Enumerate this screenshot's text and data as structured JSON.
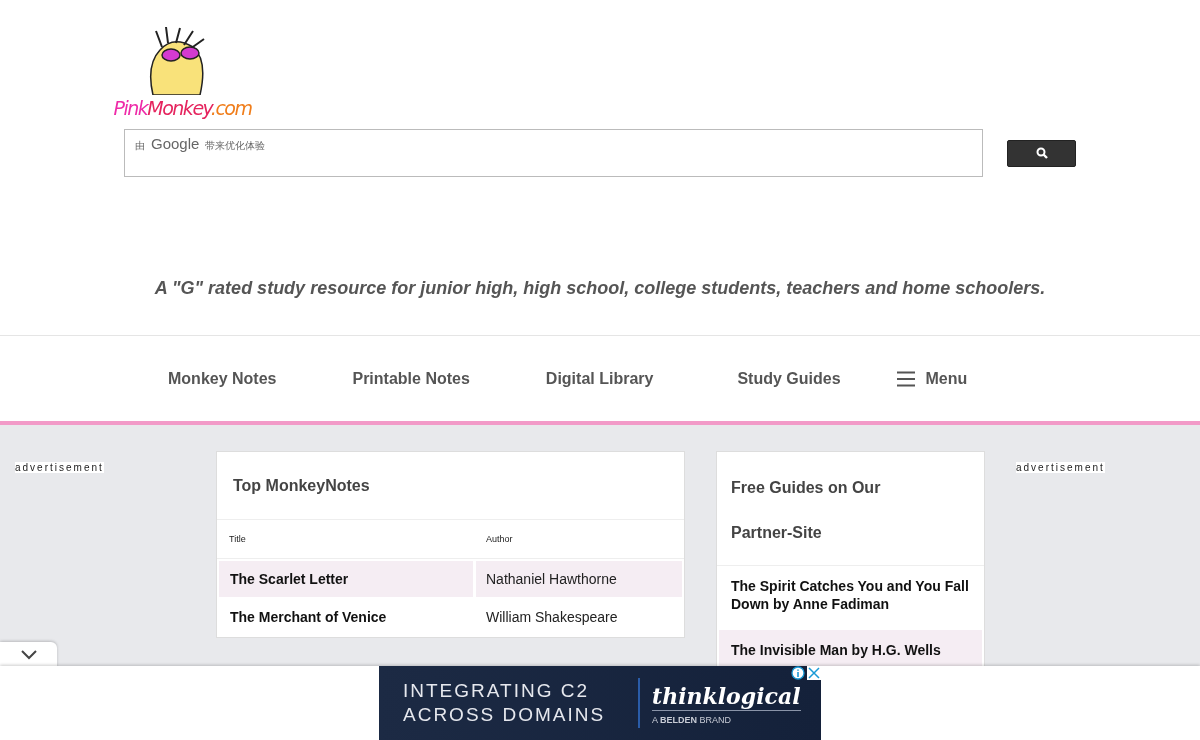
{
  "logo": {
    "parts": [
      {
        "text": "Pink",
        "color": "#ee2aa8"
      },
      {
        "text": "Monkey",
        "color": "#e5245e"
      },
      {
        "text": ".com",
        "color": "#f07d1a"
      }
    ]
  },
  "search": {
    "branding": [
      "由",
      "Google",
      "带来优化体验"
    ]
  },
  "tagline": "A \"G\" rated study resource for junior high, high school, college students, teachers and home schoolers.",
  "nav": {
    "items": [
      {
        "label": "Monkey Notes"
      },
      {
        "label": "Printable Notes"
      },
      {
        "label": "Digital Library"
      },
      {
        "label": "Study Guides"
      }
    ],
    "menu": "Menu"
  },
  "left_ad": "advertisement",
  "top_notes": {
    "title": "Top MonkeyNotes",
    "columns": [
      "Title",
      "Author"
    ],
    "rows": [
      {
        "title": "The Scarlet Letter",
        "author": "Nathaniel Hawthorne"
      },
      {
        "title": "The Merchant of Venice",
        "author": "William Shakespeare"
      }
    ]
  },
  "partner": {
    "title": "Free Guides on Our Partner-Site",
    "items": [
      "The Spirit Catches You and You Fall Down by Anne Fadiman",
      "The Invisible Man by H.G. Wells"
    ]
  },
  "right_ad": "advertisement",
  "bottom_ad": {
    "line_1": "INTEGRATING C2",
    "line_2": "ACROSS DOMAINS",
    "brand": "thinklogical",
    "brand_note": "A **BELDEN** BRAND"
  }
}
